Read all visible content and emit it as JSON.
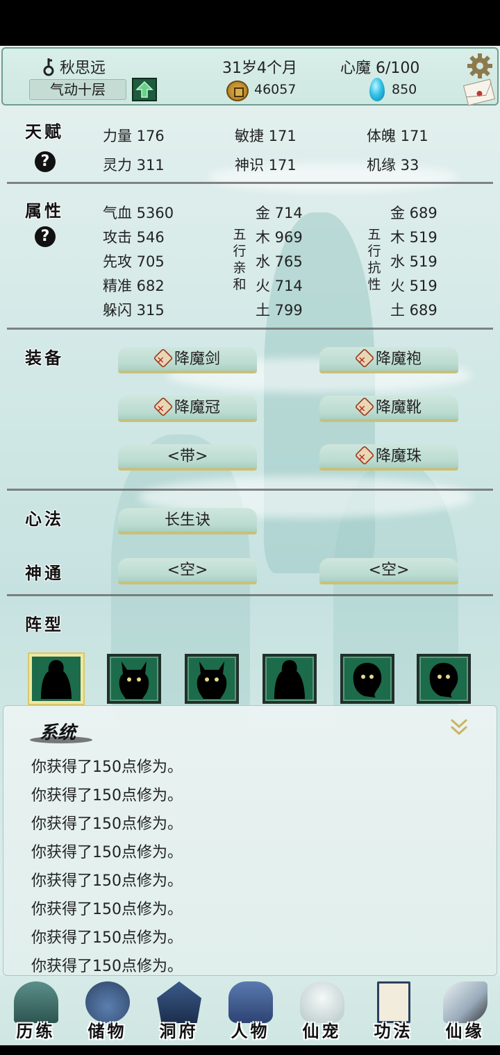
{
  "header": {
    "name": "秋思远",
    "age": "31岁4个月",
    "heart_demon": "心魔  6/100",
    "realm": "气动十层",
    "coins": "46057",
    "gems": "850"
  },
  "talent": {
    "label": "天赋",
    "help": "?",
    "stats": [
      "力量  176",
      "敏捷  171",
      "体魄  171",
      "灵力  311",
      "神识  171",
      "机缘  33"
    ]
  },
  "attributes": {
    "label": "属性",
    "help": "?",
    "base": [
      "气血  5360",
      "攻击  546",
      "先攻  705",
      "精准  682",
      "躲闪  315"
    ],
    "affinity_label": [
      "五",
      "行",
      "亲",
      "和"
    ],
    "affinity": [
      "金  714",
      "木  969",
      "水  765",
      "火  714",
      "土  799"
    ],
    "resist_label": [
      "五",
      "行",
      "抗",
      "性"
    ],
    "resist": [
      "金  689",
      "木  519",
      "水  519",
      "火  519",
      "土  689"
    ]
  },
  "equipment": {
    "label": "装备",
    "slots": [
      "降魔剑",
      "降魔袍",
      "降魔冠",
      "降魔靴",
      "<带>",
      "降魔珠"
    ]
  },
  "method": {
    "label": "心法",
    "value": "长生诀"
  },
  "supernatural": {
    "label": "神通",
    "slots": [
      "<空>",
      "<空>"
    ]
  },
  "formation": {
    "label": "阵型"
  },
  "log": {
    "title": "系统",
    "lines": [
      "你获得了150点修为。",
      "你获得了150点修为。",
      "你获得了150点修为。",
      "你获得了150点修为。",
      "你获得了150点修为。",
      "你获得了150点修为。",
      "你获得了150点修为。",
      "你获得了150点修为。"
    ]
  },
  "nav": [
    "历练",
    "储物",
    "洞府",
    "人物",
    "仙宠",
    "功法",
    "仙缘"
  ],
  "icons": {
    "key": "key-icon",
    "up": "arrow-up-icon",
    "coin": "coin-icon",
    "gem": "gem-icon",
    "settings": "gear-icon",
    "mail": "mail-icon",
    "collapse": "double-chevron-down-icon"
  }
}
